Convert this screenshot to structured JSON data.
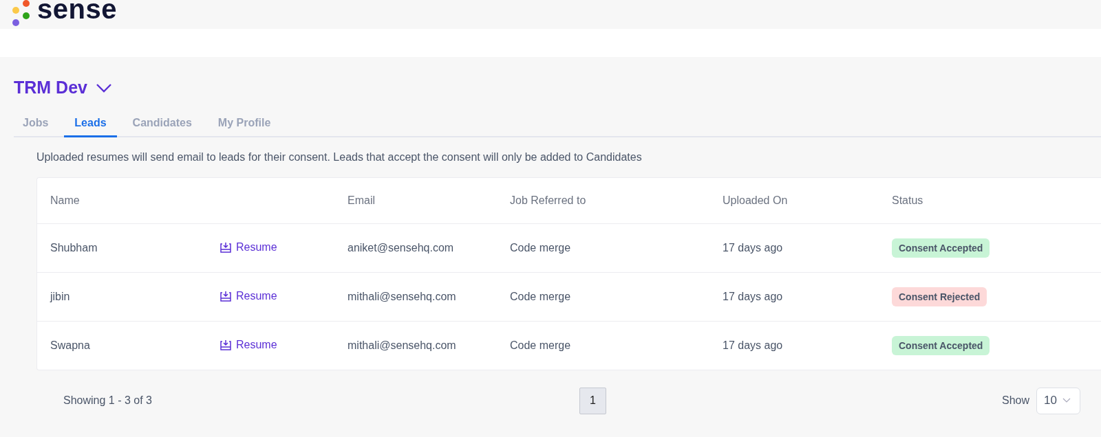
{
  "brand": {
    "name": "sense"
  },
  "workspace": {
    "title": "TRM Dev"
  },
  "tabs": [
    {
      "label": "Jobs",
      "selected": false
    },
    {
      "label": "Leads",
      "selected": true
    },
    {
      "label": "Candidates",
      "selected": false
    },
    {
      "label": "My Profile",
      "selected": false
    }
  ],
  "notice": "Uploaded resumes will send email to leads for their consent. Leads that accept the consent will only be added to Candidates",
  "table": {
    "columns": [
      "Name",
      "Email",
      "Job Referred to",
      "Uploaded On",
      "Status"
    ],
    "rows": [
      {
        "name": "Shubham",
        "resume": "Resume",
        "email": "aniket@sensehq.com",
        "job": "Code merge",
        "uploaded": "17 days ago",
        "status": {
          "label": "Consent Accepted",
          "kind": "accepted"
        }
      },
      {
        "name": "jibin",
        "resume": "Resume",
        "email": "mithali@sensehq.com",
        "job": "Code merge",
        "uploaded": "17 days ago",
        "status": {
          "label": "Consent Rejected",
          "kind": "rejected"
        }
      },
      {
        "name": "Swapna",
        "resume": "Resume",
        "email": "mithali@sensehq.com",
        "job": "Code merge",
        "uploaded": "17 days ago",
        "status": {
          "label": "Consent Accepted",
          "kind": "accepted"
        }
      }
    ]
  },
  "footer": {
    "summary": "Showing 1 - 3 of 3",
    "pages": [
      {
        "label": "1",
        "selected": true
      }
    ],
    "show_label": "Show",
    "page_size": "10"
  }
}
